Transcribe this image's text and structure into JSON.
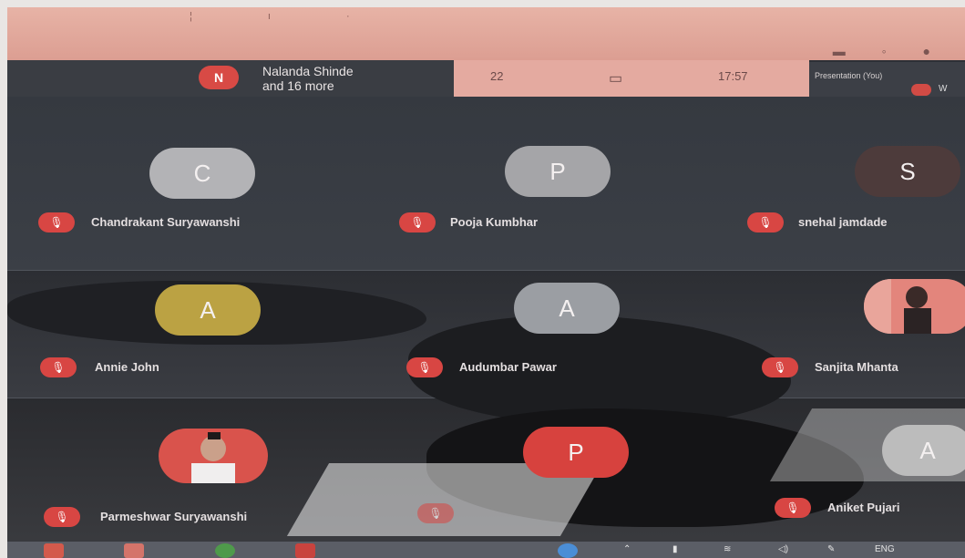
{
  "presenter": {
    "initial": "N",
    "name": "Nalanda Shinde",
    "more": "and 16 more"
  },
  "info_bar": {
    "participants": "22",
    "time": "17:57"
  },
  "presentation": {
    "label": "Presentation (You)",
    "more": "W"
  },
  "participants": [
    {
      "initial": "C",
      "name": "Chandrakant Suryawanshi",
      "avatar_color": "#b3b3b6"
    },
    {
      "initial": "P",
      "name": "Pooja Kumbhar",
      "avatar_color": "#a5a5a8"
    },
    {
      "initial": "S",
      "name": "snehal jamdade",
      "avatar_color": "#4d3b3b"
    },
    {
      "initial": "A",
      "name": "Annie John",
      "avatar_color": "#bba243"
    },
    {
      "initial": "A",
      "name": "Audumbar Pawar",
      "avatar_color": "#9b9ea3"
    },
    {
      "initial": "",
      "name": "Sanjita Mhanta",
      "avatar_color": "#e3857c"
    },
    {
      "initial": "",
      "name": "Parmeshwar Suryawanshi",
      "avatar_color": "#d9534c"
    },
    {
      "initial": "P",
      "name": "",
      "avatar_color": "#d7423e"
    },
    {
      "initial": "A",
      "name": "Aniket Pujari",
      "avatar_color": "#bcbcbc"
    }
  ],
  "taskbar": {
    "lang": "ENG"
  },
  "icons": {
    "mic": "mic-off-icon"
  }
}
